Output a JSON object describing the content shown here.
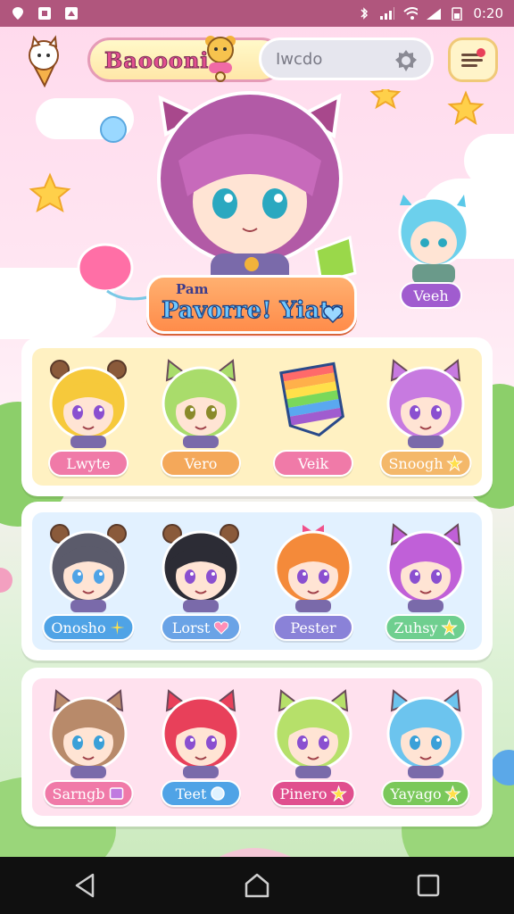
{
  "status_bar": {
    "time": "0:20"
  },
  "header": {
    "app_title": "Baoooni",
    "search_placeholder": "Iwcdo"
  },
  "hero": {
    "subtitle": "Pam",
    "title": "Pavorre! Yiats",
    "side_character_label": "Veeh"
  },
  "rows": [
    {
      "bg": "#fff1c2",
      "cards": [
        {
          "label": "Lwyte",
          "label_color": "#f07aa8",
          "hair": "#f6c93b",
          "ears": "bear",
          "eyes": "#8a4fd0"
        },
        {
          "label": "Vero",
          "label_color": "#f4a85a",
          "hair": "#a9dc6b",
          "ears": "cat",
          "eyes": "#8a8a2a"
        },
        {
          "label": "Veik",
          "label_color": "#f07aa8",
          "hair": "rainbow",
          "ears": "none",
          "eyes": "#000"
        },
        {
          "label": "Snoogh",
          "label_color": "#f4b86a",
          "hair": "#c77ae0",
          "ears": "cat",
          "eyes": "#8a4fd0",
          "badge": "star"
        }
      ]
    },
    {
      "bg": "#e2f1ff",
      "cards": [
        {
          "label": "Onosho",
          "label_color": "#4fa3e6",
          "hair": "#5b5b6b",
          "ears": "bear",
          "eyes": "#4fa3e6",
          "badge": "sparkle"
        },
        {
          "label": "Lorst",
          "label_color": "#6aa3e6",
          "hair": "#2c2c35",
          "ears": "bear",
          "eyes": "#8a4fd0",
          "badge": "heart"
        },
        {
          "label": "Pester",
          "label_color": "#8a82d8",
          "hair": "#f48a3a",
          "ears": "bow",
          "eyes": "#8a4fd0"
        },
        {
          "label": "Zuhsy",
          "label_color": "#6fcf8f",
          "hair": "#c060d8",
          "ears": "cat",
          "eyes": "#8a4fd0",
          "badge": "star"
        }
      ]
    },
    {
      "bg": "#ffe1ee",
      "cards": [
        {
          "label": "Sarngb",
          "label_color": "#f07aa8",
          "hair": "#b88a6a",
          "ears": "cat",
          "eyes": "#3aa0d8",
          "badge": "box"
        },
        {
          "label": "Teet",
          "label_color": "#4fa3e6",
          "hair": "#e8405a",
          "ears": "cat",
          "eyes": "#8a4fd0",
          "badge": "bubble"
        },
        {
          "label": "Pinero",
          "label_color": "#e04f8e",
          "hair": "#b6e06a",
          "ears": "cat",
          "eyes": "#8a4fd0",
          "badge": "star"
        },
        {
          "label": "Yayago",
          "label_color": "#7ac85a",
          "hair": "#6cc4ee",
          "ears": "cat",
          "eyes": "#3aa0d8",
          "badge": "star"
        }
      ]
    }
  ],
  "nav": {
    "back_icon": "back-triangle",
    "home_icon": "home-pentagon",
    "recents_icon": "recents-square"
  }
}
